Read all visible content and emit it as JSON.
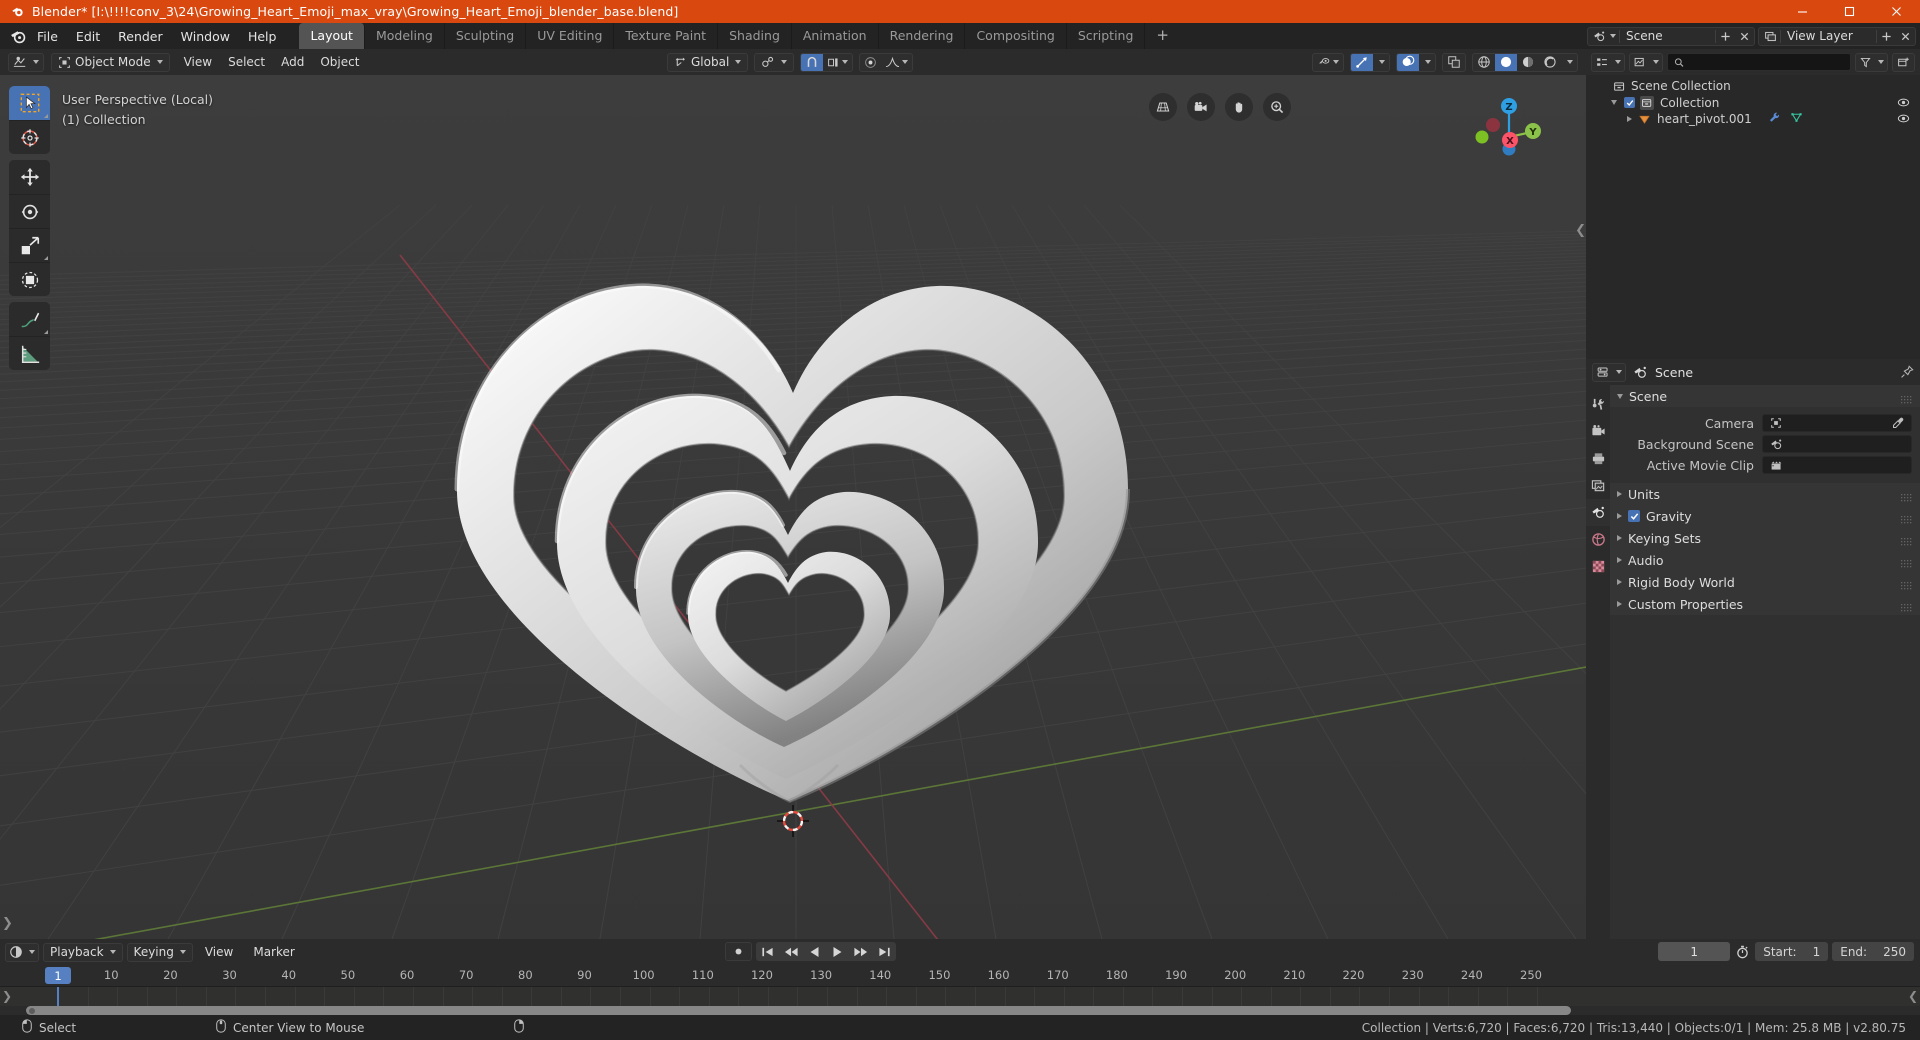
{
  "window": {
    "title": "Blender* [I:\\!!!!conv_3\\24\\Growing_Heart_Emoji_max_vray\\Growing_Heart_Emoji_blender_base.blend]",
    "accent": "#d9480f"
  },
  "topbar": {
    "menus": [
      "File",
      "Edit",
      "Render",
      "Window",
      "Help"
    ],
    "workspaces": [
      {
        "label": "Layout",
        "active": true
      },
      {
        "label": "Modeling",
        "active": false
      },
      {
        "label": "Sculpting",
        "active": false
      },
      {
        "label": "UV Editing",
        "active": false
      },
      {
        "label": "Texture Paint",
        "active": false
      },
      {
        "label": "Shading",
        "active": false
      },
      {
        "label": "Animation",
        "active": false
      },
      {
        "label": "Rendering",
        "active": false
      },
      {
        "label": "Compositing",
        "active": false
      },
      {
        "label": "Scripting",
        "active": false
      }
    ],
    "add_workspace": "+",
    "scene_name": "Scene",
    "view_layer_name": "View Layer"
  },
  "viewport": {
    "mode": "Object Mode",
    "menus": [
      "View",
      "Select",
      "Add",
      "Object"
    ],
    "transform_orientation": "Global",
    "overlay_text_line1": "User Perspective (Local)",
    "overlay_text_line2": "(1) Collection",
    "gizmo_axes": [
      "X",
      "Y",
      "Z"
    ],
    "gizmo_colors": {
      "x": "#fc5368",
      "y": "#8bc34a",
      "z": "#2f9fe3"
    }
  },
  "outliner": {
    "search_placeholder": "",
    "rows": [
      {
        "label": "Scene Collection",
        "indent": 0,
        "icon": "collection-icon",
        "expand": "none",
        "checkbox": false,
        "eye": false
      },
      {
        "label": "Collection",
        "indent": 1,
        "icon": "collection-icon",
        "expand": "down",
        "checkbox": true,
        "eye": true
      },
      {
        "label": "heart_pivot.001",
        "indent": 2,
        "icon": "empty-object-icon",
        "expand": "right",
        "checkbox": false,
        "eye": true,
        "extra_icons": [
          "modifier-wrench-icon",
          "mesh-data-icon"
        ]
      }
    ]
  },
  "properties": {
    "breadcrumb_icon": "scene-icon",
    "breadcrumb": "Scene",
    "panels": [
      {
        "title": "Scene",
        "open": true,
        "rows": [
          {
            "label": "Camera",
            "value": "",
            "field_icon": "camera-icon",
            "eyedropper": true
          },
          {
            "label": "Background Scene",
            "value": "",
            "field_icon": "scene-icon",
            "eyedropper": false
          },
          {
            "label": "Active Movie Clip",
            "value": "",
            "field_icon": "clip-icon",
            "eyedropper": false
          }
        ]
      },
      {
        "title": "Units",
        "open": false,
        "rows": []
      },
      {
        "title": "Gravity",
        "open": false,
        "checkbox": true,
        "rows": []
      },
      {
        "title": "Keying Sets",
        "open": false,
        "rows": []
      },
      {
        "title": "Audio",
        "open": false,
        "rows": []
      },
      {
        "title": "Rigid Body World",
        "open": false,
        "rows": []
      },
      {
        "title": "Custom Properties",
        "open": false,
        "rows": []
      }
    ]
  },
  "timeline": {
    "menus": [
      "Playback",
      "Keying",
      "View",
      "Marker"
    ],
    "current_frame": "1",
    "start_label": "Start:",
    "start_value": "1",
    "end_label": "End:",
    "end_value": "250",
    "ticks": [
      1,
      10,
      20,
      30,
      40,
      50,
      60,
      70,
      80,
      90,
      100,
      110,
      120,
      130,
      140,
      150,
      160,
      170,
      180,
      190,
      200,
      210,
      220,
      230,
      240,
      250
    ],
    "playhead_frame": 1
  },
  "statusbar": {
    "hints": [
      {
        "icon": "mouse-left-icon",
        "label": "Select"
      },
      {
        "icon": "mouse-middle-icon",
        "label": "Center View to Mouse"
      },
      {
        "icon": "mouse-right-icon",
        "label": ""
      }
    ],
    "stats": "Collection | Verts:6,720 | Faces:6,720 | Tris:13,440 | Objects:0/1 | Mem: 25.8 MB | v2.80.75"
  }
}
